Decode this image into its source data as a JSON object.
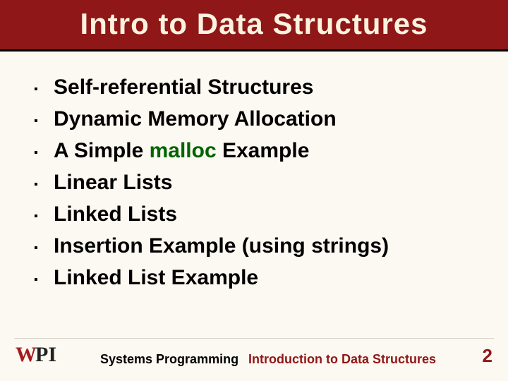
{
  "title": "Intro to Data Structures",
  "bullets": [
    {
      "text": "Self-referential Structures"
    },
    {
      "text": "Dynamic Memory Allocation"
    },
    {
      "prefix": "A Simple ",
      "keyword": "malloc",
      "suffix": " Example"
    },
    {
      "text": "Linear Lists"
    },
    {
      "text": "Linked Lists"
    },
    {
      "text": "Insertion Example (using strings)"
    },
    {
      "text": "Linked List Example"
    }
  ],
  "footer": {
    "left": "Systems Programming",
    "center": "Introduction to Data Structures",
    "page": "2"
  },
  "logo": {
    "w": "W",
    "pi": "PI"
  }
}
